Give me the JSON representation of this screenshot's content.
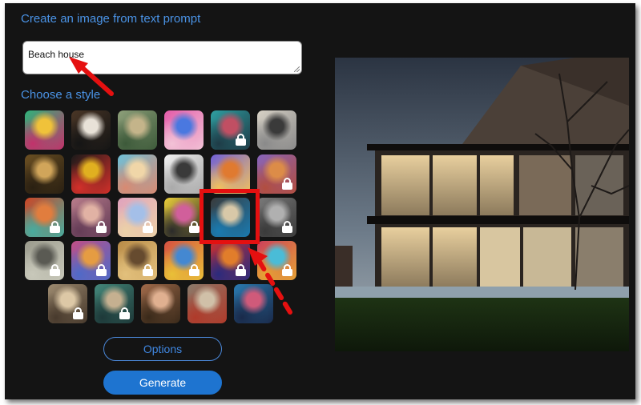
{
  "header": {
    "title": "Create an image from text prompt"
  },
  "prompt": {
    "value": "Beach house"
  },
  "styles": {
    "heading": "Choose a style",
    "tiles": [
      {
        "name": "style-abstract-paint",
        "colors": [
          "#2fb37a",
          "#f0c23a",
          "#c2326b"
        ],
        "locked": false
      },
      {
        "name": "style-panda",
        "colors": [
          "#4a3626",
          "#e8e2d8",
          "#151515"
        ],
        "locked": false
      },
      {
        "name": "style-fantasy-landscape",
        "colors": [
          "#8ea07a",
          "#c4b48a",
          "#3d5a3a"
        ],
        "locked": false
      },
      {
        "name": "style-robot",
        "colors": [
          "#e35aa8",
          "#4a78e0",
          "#f2c2d6"
        ],
        "locked": false
      },
      {
        "name": "style-cyan-portrait",
        "colors": [
          "#1fa3a6",
          "#d14a62",
          "#1a3d4a"
        ],
        "locked": true
      },
      {
        "name": "style-sketch-scene",
        "colors": [
          "#d8d2c6",
          "#3a3a3a",
          "#8a8a8a"
        ],
        "locked": false
      },
      {
        "name": "style-mona-lisa",
        "colors": [
          "#6b4f22",
          "#d1a55a",
          "#2a2012"
        ],
        "locked": false
      },
      {
        "name": "style-flower-vase",
        "colors": [
          "#1a1a1a",
          "#e0b020",
          "#d2302a"
        ],
        "locked": false
      },
      {
        "name": "style-ballet",
        "colors": [
          "#6ec0d8",
          "#f0d6a8",
          "#d88a72"
        ],
        "locked": false
      },
      {
        "name": "style-engraving",
        "colors": [
          "#f0f0f0",
          "#3a3a3a",
          "#aaaaaa"
        ],
        "locked": false
      },
      {
        "name": "style-orange-box",
        "colors": [
          "#7060d8",
          "#e07a30",
          "#f0c060"
        ],
        "locked": false
      },
      {
        "name": "style-fox",
        "colors": [
          "#8a62c8",
          "#e88a3a",
          "#c04a3a"
        ],
        "locked": true
      },
      {
        "name": "style-red-face",
        "colors": [
          "#e0401a",
          "#f07a30",
          "#3ab0a0"
        ],
        "locked": true
      },
      {
        "name": "style-soft-portrait",
        "colors": [
          "#c07a8a",
          "#e8b0a0",
          "#6a3a5a"
        ],
        "locked": true
      },
      {
        "name": "style-pastel-blur",
        "colors": [
          "#e8a0c0",
          "#a0c0f0",
          "#f0d0a0"
        ],
        "locked": true
      },
      {
        "name": "style-marilyn",
        "colors": [
          "#f0d020",
          "#e05aa0",
          "#2a2a2a"
        ],
        "locked": true
      },
      {
        "name": "style-architecture-selected",
        "colors": [
          "#3a3a3a",
          "#d8c8a8",
          "#1a7ab0"
        ],
        "locked": false
      },
      {
        "name": "style-gray-photo",
        "colors": [
          "#7a7a7a",
          "#b0b0b0",
          "#3a3a3a"
        ],
        "locked": true
      },
      {
        "name": "style-gray-texture",
        "colors": [
          "#9a9a8a",
          "#5a5a52",
          "#c8c8b8"
        ],
        "locked": true
      },
      {
        "name": "style-glow-figure",
        "colors": [
          "#d04a8a",
          "#f09a30",
          "#4a6ad8"
        ],
        "locked": true
      },
      {
        "name": "style-golden-abstract",
        "colors": [
          "#c08a3a",
          "#6a4a2a",
          "#e8c070"
        ],
        "locked": true
      },
      {
        "name": "style-pattern-grid",
        "colors": [
          "#e84a3a",
          "#3a8ae0",
          "#f0c020"
        ],
        "locked": true
      },
      {
        "name": "style-red-stripes",
        "colors": [
          "#e02a2a",
          "#f07a1a",
          "#2a2a8a"
        ],
        "locked": true
      },
      {
        "name": "style-colorful-swirl",
        "colors": [
          "#e03a5a",
          "#3ac0e0",
          "#f0a020"
        ],
        "locked": true
      },
      {
        "name": "style-faun",
        "colors": [
          "#a08a6a",
          "#e0c8a0",
          "#4a3a2a"
        ],
        "locked": true
      },
      {
        "name": "style-teal-portrait",
        "colors": [
          "#3a8a7a",
          "#c8b08a",
          "#1a3a3a"
        ],
        "locked": true
      },
      {
        "name": "style-renaissance-woman",
        "colors": [
          "#a06a4a",
          "#e0b090",
          "#3a2a1a"
        ],
        "locked": false
      },
      {
        "name": "style-pirate",
        "colors": [
          "#8a7a6a",
          "#d0c0a8",
          "#b03a2a"
        ],
        "locked": false
      },
      {
        "name": "style-neon-face",
        "colors": [
          "#2a7ab0",
          "#d05a7a",
          "#1a2a4a"
        ],
        "locked": false
      }
    ]
  },
  "buttons": {
    "options": "Options",
    "generate": "Generate"
  },
  "accent": "#4a93e6"
}
